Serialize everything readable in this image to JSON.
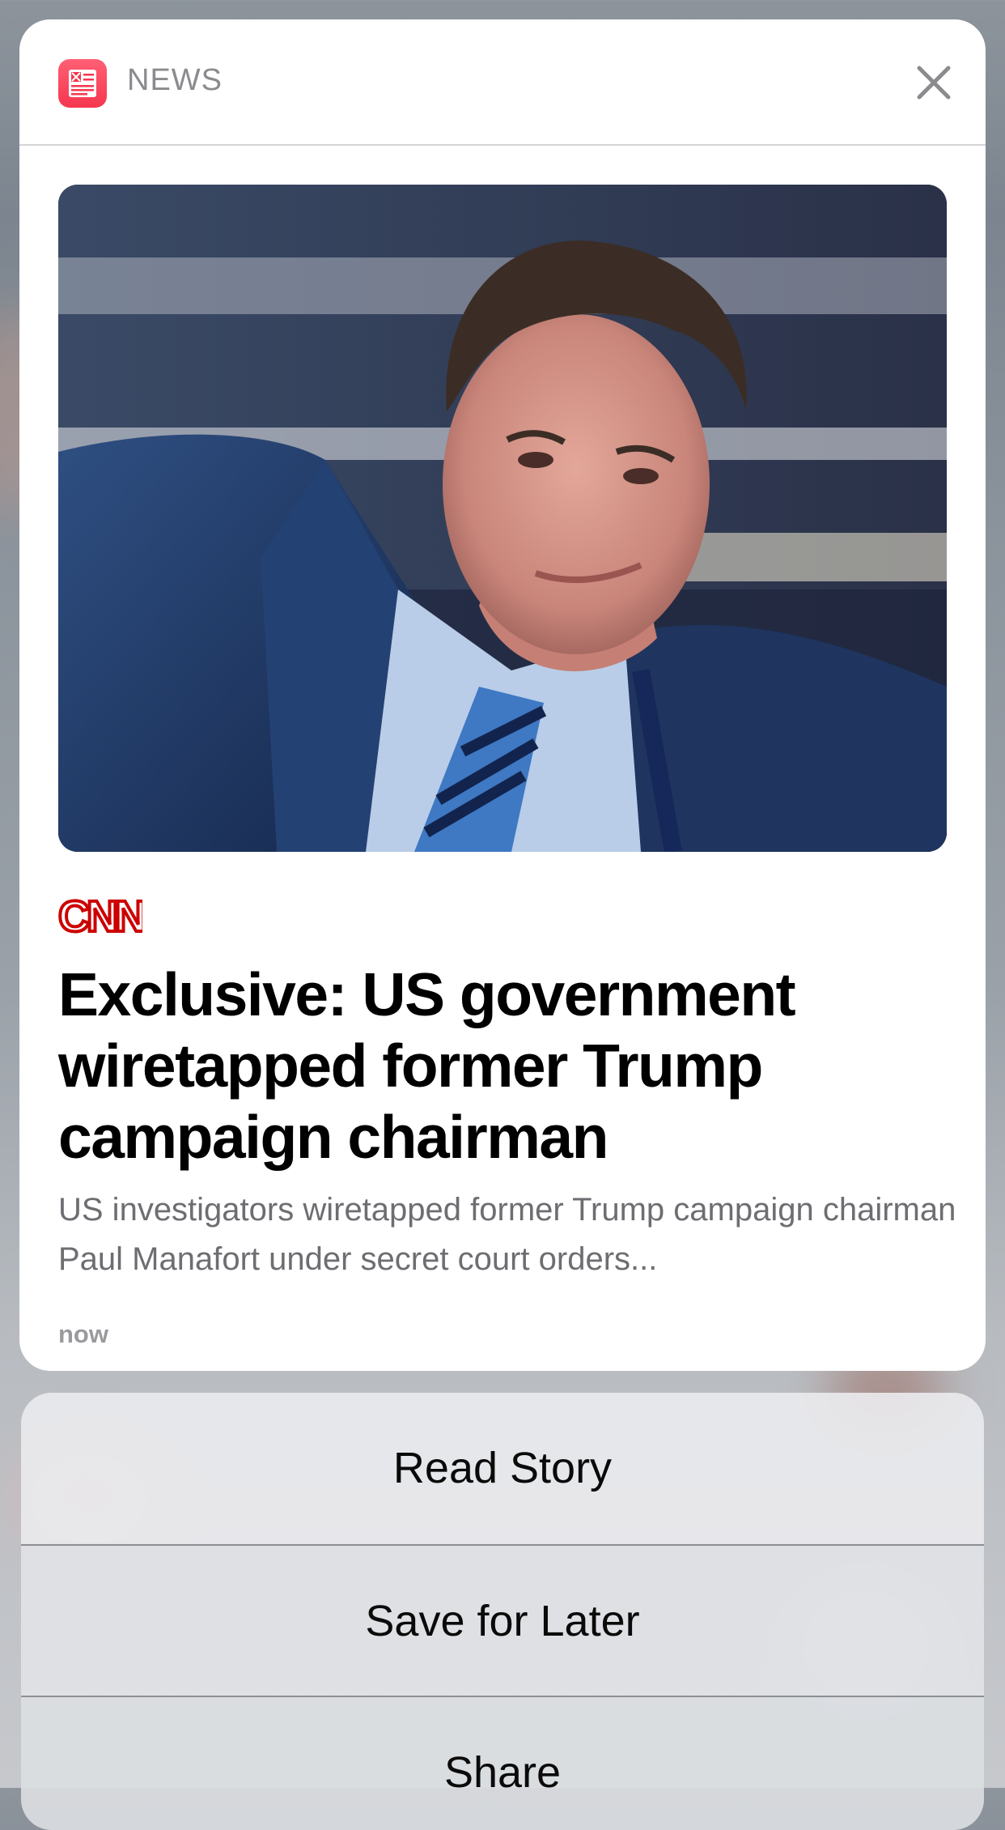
{
  "notification": {
    "app_name": "NEWS",
    "app_icon": "news-app-icon",
    "close_icon": "close-icon",
    "source": "CNN",
    "headline": "Exclusive: US government wiretapped former Trump campaign chairman",
    "summary": "US investigators wiretapped former Trump campaign chairman Paul Manafort under secret court orders...",
    "timestamp": "now",
    "image": "photo-man-in-suit-and-blue-striped-tie"
  },
  "actions": [
    {
      "label": "Read Story"
    },
    {
      "label": "Save for Later"
    },
    {
      "label": "Share"
    }
  ],
  "colors": {
    "app_icon": "#f5364f",
    "source_logo": "#cc0000",
    "headline": "#000000",
    "summary": "#6d6d72"
  }
}
